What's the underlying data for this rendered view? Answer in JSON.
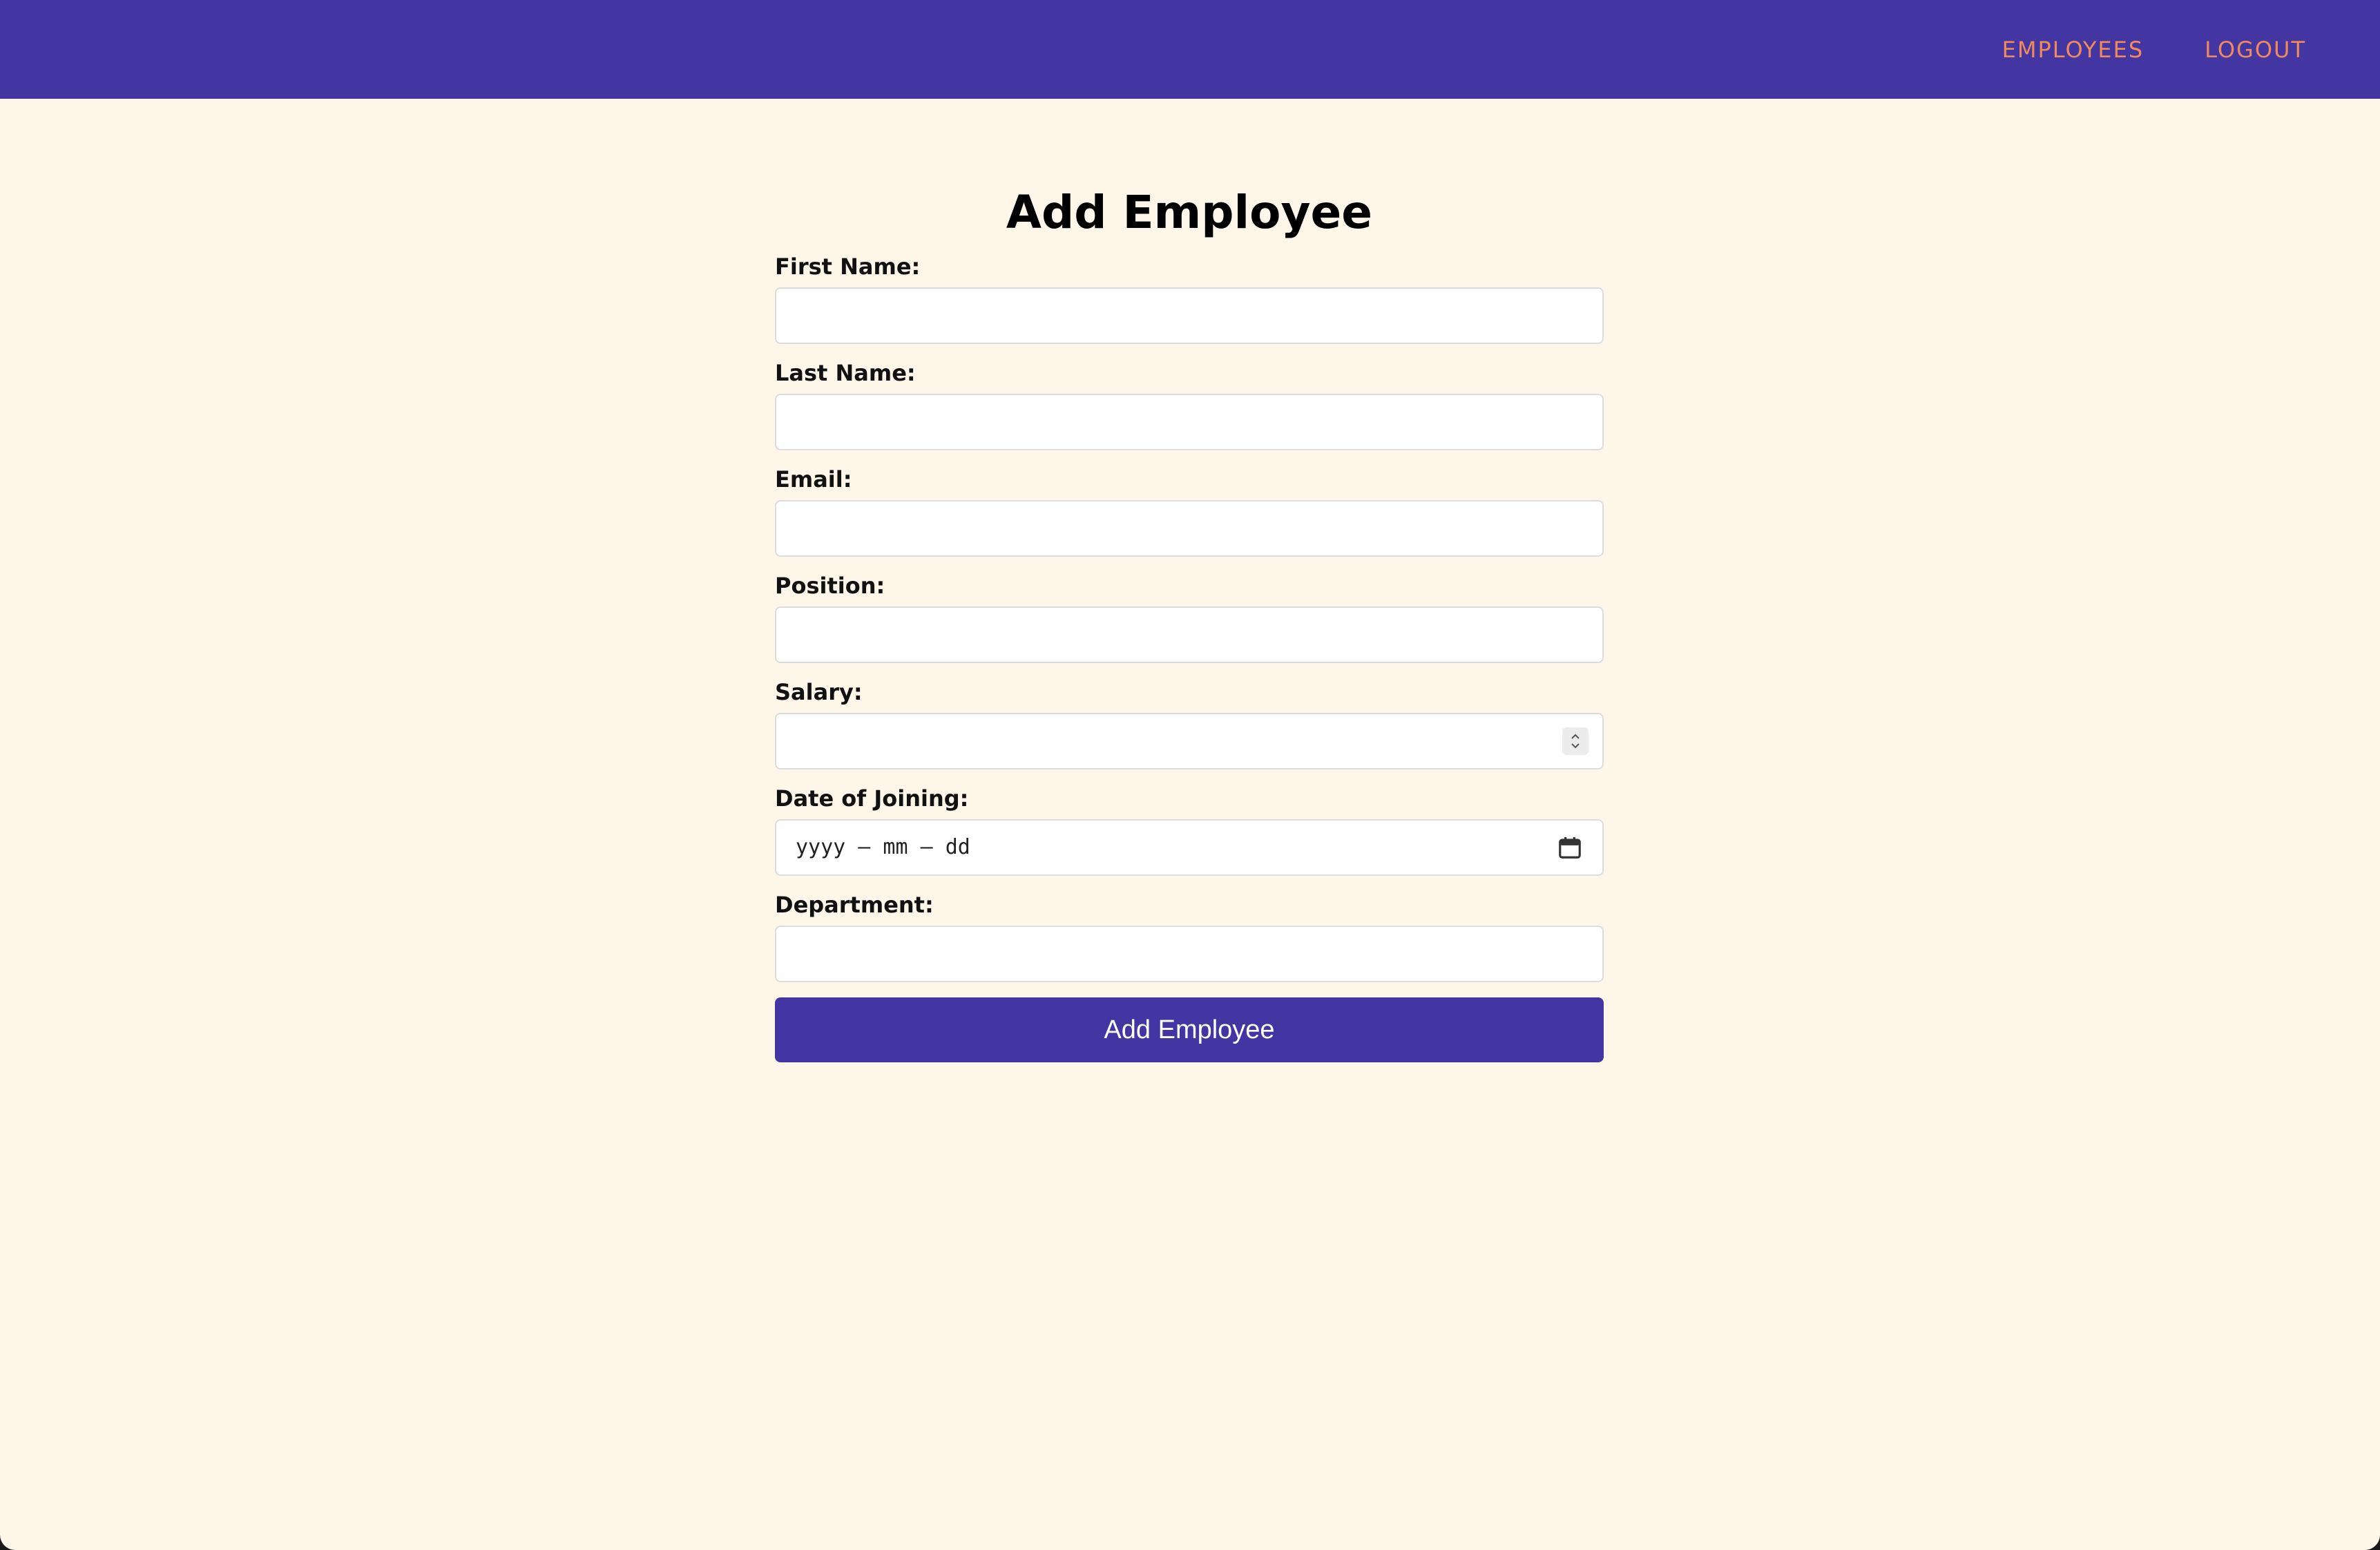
{
  "navbar": {
    "links": [
      {
        "label": "EMPLOYEES"
      },
      {
        "label": "LOGOUT"
      }
    ]
  },
  "colors": {
    "brand": "#4335a2",
    "accent": "#f08a5a",
    "background": "#fdf6e9"
  },
  "form": {
    "title": "Add Employee",
    "fields": {
      "first_name": {
        "label": "First Name:",
        "value": ""
      },
      "last_name": {
        "label": "Last Name:",
        "value": ""
      },
      "email": {
        "label": "Email:",
        "value": ""
      },
      "position": {
        "label": "Position:",
        "value": ""
      },
      "salary": {
        "label": "Salary:",
        "value": ""
      },
      "date_of_joining": {
        "label": "Date of Joining:",
        "placeholder": "yyyy – mm – dd"
      },
      "department": {
        "label": "Department:",
        "value": ""
      }
    },
    "submit_label": "Add Employee"
  },
  "icons": {
    "salary_spinner": "chevron-up-down-icon",
    "date_picker": "calendar-icon"
  }
}
